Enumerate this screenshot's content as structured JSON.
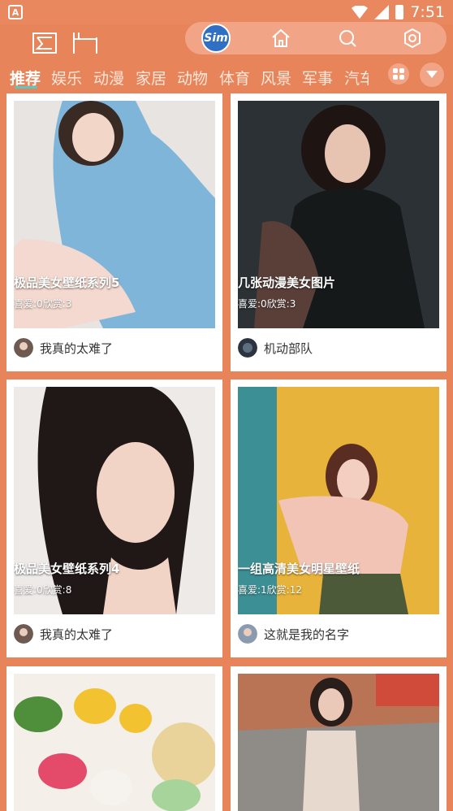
{
  "status": {
    "time": "7:51",
    "left_glyph": "A"
  },
  "header": {
    "badge_text": "Sim"
  },
  "tabs": [
    "推荐",
    "娱乐",
    "动漫",
    "家居",
    "动物",
    "体育",
    "风景",
    "军事",
    "汽车"
  ],
  "cards": [
    {
      "title": "极品美女壁纸系列5",
      "stats": "喜爱:0欣赏:3",
      "user": "我真的太难了"
    },
    {
      "title": "几张动漫美女图片",
      "stats": "喜爱:0欣赏:3",
      "user": "机动部队"
    },
    {
      "title": "极品美女壁纸系列4",
      "stats": "喜爱:0欣赏:8",
      "user": "我真的太难了"
    },
    {
      "title": "一组高清美女明星壁纸",
      "stats": "喜爱:1欣赏:12",
      "user": "这就是我的名字"
    }
  ],
  "colors": {
    "accent": "#E8845A",
    "pill": "#F2A486",
    "underline": "#5BC7C5"
  }
}
